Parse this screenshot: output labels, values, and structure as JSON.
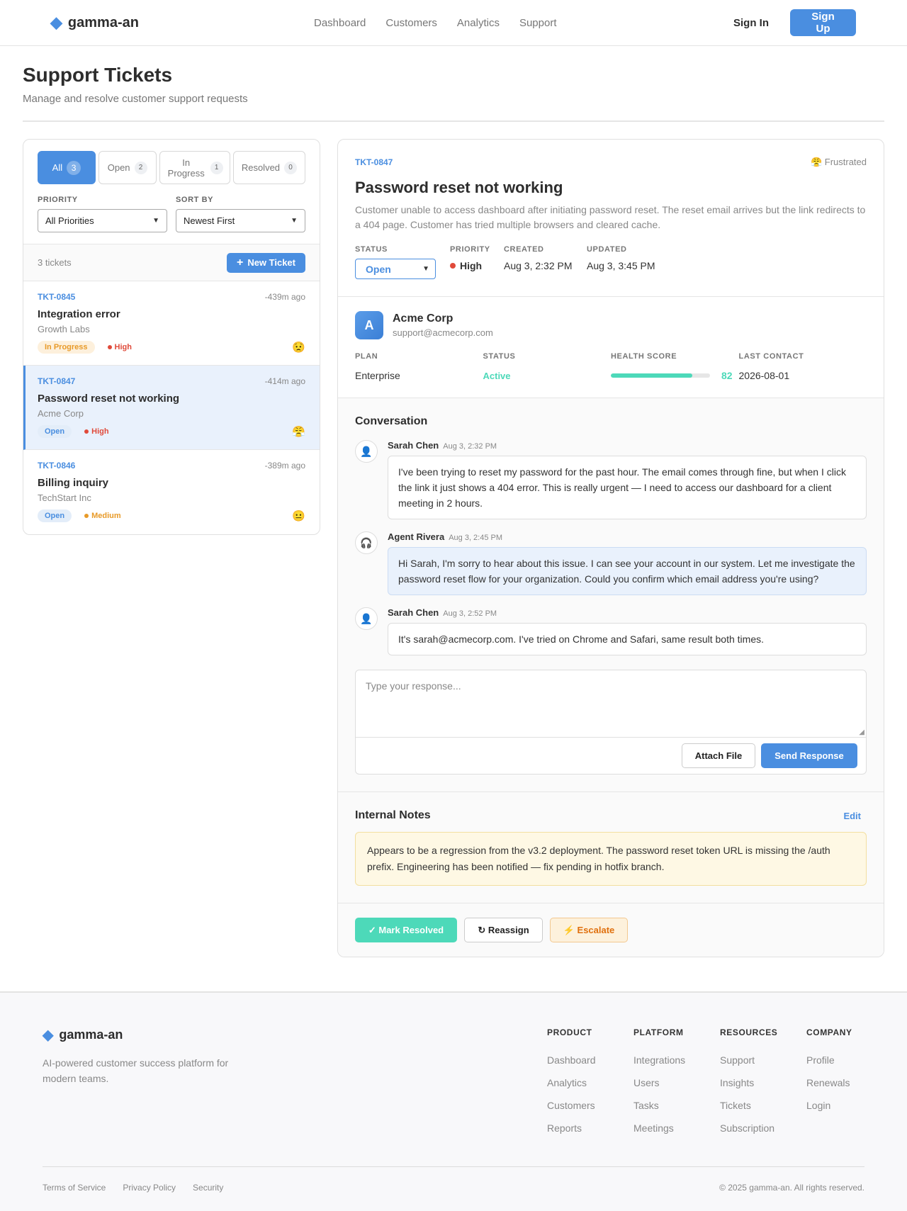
{
  "brand": {
    "name": "gamma-an",
    "icon": "diamond-icon",
    "accent": "#4a8ee0"
  },
  "nav": {
    "links": [
      "Dashboard",
      "Customers",
      "Analytics",
      "Support"
    ],
    "sign_in": "Sign In",
    "sign_up": "Sign Up"
  },
  "page": {
    "title": "Support Tickets",
    "subtitle": "Manage and resolve customer support requests"
  },
  "filters": {
    "tabs": [
      {
        "label": "All",
        "count": "3",
        "active": true
      },
      {
        "label": "Open",
        "count": "2"
      },
      {
        "label": "In Progress",
        "count": "1"
      },
      {
        "label": "Resolved",
        "count": "0"
      }
    ],
    "priority_label": "PRIORITY",
    "priority_value": "All Priorities",
    "sort_label": "SORT BY",
    "sort_value": "Newest First"
  },
  "list": {
    "count_text": "3 tickets",
    "new_ticket": "New Ticket",
    "tickets": [
      {
        "id": "TKT-0845",
        "age": "-439m ago",
        "title": "Integration error",
        "company": "Growth Labs",
        "status": "In Progress",
        "priority": "High",
        "mood": "😟"
      },
      {
        "id": "TKT-0847",
        "age": "-414m ago",
        "title": "Password reset not working",
        "company": "Acme Corp",
        "status": "Open",
        "priority": "High",
        "mood": "😤"
      },
      {
        "id": "TKT-0846",
        "age": "-389m ago",
        "title": "Billing inquiry",
        "company": "TechStart Inc",
        "status": "Open",
        "priority": "Medium",
        "mood": "😐"
      }
    ]
  },
  "detail": {
    "id": "TKT-0847",
    "mood": "😤 Frustrated",
    "title": "Password reset not working",
    "description": "Customer unable to access dashboard after initiating password reset. The reset email arrives but the link redirects to a 404 page. Customer has tried multiple browsers and cleared cache.",
    "status_label": "STATUS",
    "status_value": "Open",
    "priority_label": "PRIORITY",
    "priority_value": "High",
    "created_label": "CREATED",
    "created_value": "Aug 3, 2:32 PM",
    "updated_label": "UPDATED",
    "updated_value": "Aug 3, 3:45 PM"
  },
  "customer": {
    "initial": "A",
    "name": "Acme Corp",
    "email": "support@acmecorp.com",
    "plan_label": "PLAN",
    "plan_value": "Enterprise",
    "status_label": "STATUS",
    "status_value": "Active",
    "health_label": "HEALTH SCORE",
    "health_value": "82",
    "health_fraction": 0.82,
    "contact_label": "LAST CONTACT",
    "contact_value": "2026-08-01"
  },
  "conversation": {
    "title": "Conversation",
    "messages": [
      {
        "author": "Sarah Chen",
        "time": "Aug 3, 2:32 PM",
        "icon": "user-icon",
        "role": "customer",
        "text": "I've been trying to reset my password for the past hour. The email comes through fine, but when I click the link it just shows a 404 error. This is really urgent — I need to access our dashboard for a client meeting in 2 hours."
      },
      {
        "author": "Agent Rivera",
        "time": "Aug 3, 2:45 PM",
        "icon": "headset-icon",
        "role": "agent",
        "text": "Hi Sarah, I'm sorry to hear about this issue. I can see your account in our system. Let me investigate the password reset flow for your organization. Could you confirm which email address you're using?"
      },
      {
        "author": "Sarah Chen",
        "time": "Aug 3, 2:52 PM",
        "icon": "user-icon",
        "role": "customer",
        "text": "It's sarah@acmecorp.com. I've tried on Chrome and Safari, same result both times."
      }
    ],
    "reply_placeholder": "Type your response...",
    "attach": "Attach File",
    "send": "Send Response"
  },
  "notes": {
    "title": "Internal Notes",
    "edit": "Edit",
    "text": "Appears to be a regression from the v3.2 deployment. The password reset token URL is missing the /auth prefix. Engineering has been notified — fix pending in hotfix branch."
  },
  "actions": {
    "resolve": "✓ Mark Resolved",
    "reassign": "↻ Reassign",
    "escalate": "⚡ Escalate"
  },
  "footer": {
    "brand": "gamma-an",
    "tagline": "AI-powered customer success platform for modern teams.",
    "columns": [
      {
        "title": "PRODUCT",
        "links": [
          "Dashboard",
          "Analytics",
          "Customers",
          "Reports"
        ]
      },
      {
        "title": "PLATFORM",
        "links": [
          "Integrations",
          "Users",
          "Tasks",
          "Meetings"
        ]
      },
      {
        "title": "RESOURCES",
        "links": [
          "Support",
          "Insights",
          "Tickets",
          "Subscription"
        ]
      },
      {
        "title": "COMPANY",
        "links": [
          "Profile",
          "Renewals",
          "Login"
        ]
      }
    ],
    "legal": [
      "Terms of Service",
      "Privacy Policy",
      "Security"
    ],
    "copyright": "© 2025 gamma-an. All rights reserved."
  }
}
